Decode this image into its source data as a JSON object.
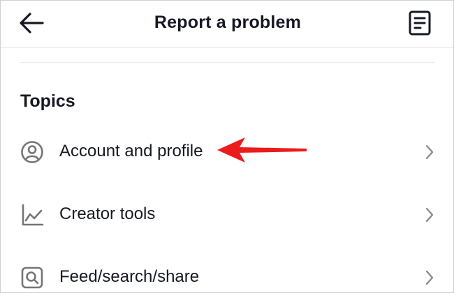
{
  "header": {
    "title": "Report a problem",
    "back_icon": "arrow-left-icon",
    "history_icon": "document-list-icon"
  },
  "section": {
    "title": "Topics"
  },
  "topics": [
    {
      "label": "Account and profile",
      "icon": "user-circle-icon"
    },
    {
      "label": "Creator tools",
      "icon": "line-chart-icon"
    },
    {
      "label": "Feed/search/share",
      "icon": "search-square-icon"
    }
  ],
  "colors": {
    "text": "#161823",
    "icon_gray": "#757575",
    "chevron_gray": "#8a8b91",
    "annotation_red": "#ea1c1c",
    "divider": "#ececee"
  }
}
